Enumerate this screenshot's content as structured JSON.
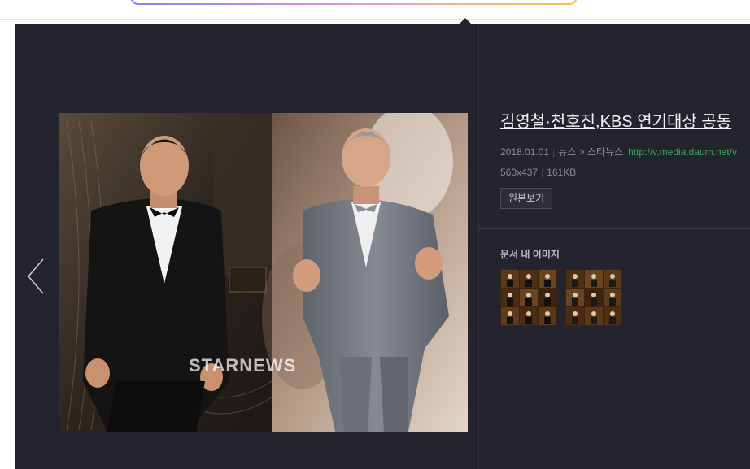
{
  "viewer": {
    "article_title": "김영철·천호진,KBS 연기대상 공동",
    "date": "2018.01.01",
    "category": "뉴스",
    "breadcrumb_arrow": ">",
    "source": "스타뉴스",
    "source_url": "http://v.media.daum.net/v",
    "dimensions": "560x437",
    "file_size": "161KB",
    "original_button": "원본보기",
    "section_title": "문서 내 이미지",
    "watermark": "STARNEWS",
    "thumbnails": [
      {
        "name": "thumbnail-1"
      },
      {
        "name": "thumbnail-2"
      }
    ],
    "colors": {
      "background": "#24242e",
      "link_green": "#3aa55a",
      "title": "#f1f1f1"
    }
  }
}
